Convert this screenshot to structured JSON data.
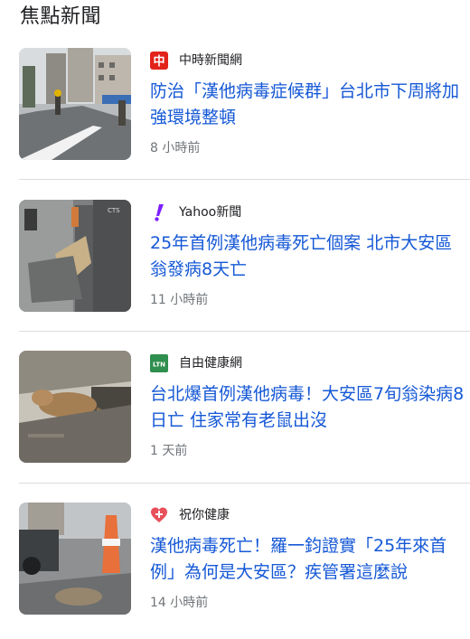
{
  "section": {
    "title": "焦點新聞"
  },
  "articles": [
    {
      "source": "中時新聞網",
      "headline": "防治「漢他病毒症候群」台北市下周將加強環境整頓",
      "time": "8 小時前"
    },
    {
      "source": "Yahoo新聞",
      "headline": "25年首例漢他病毒死亡個案 北市大安區翁發病8天亡",
      "time": "11 小時前"
    },
    {
      "source": "自由健康網",
      "source_logo_text": "LTN",
      "headline": "台北爆首例漢他病毒！大安區7旬翁染病8日亡 住家常有老鼠出沒",
      "time": "1 天前"
    },
    {
      "source": "祝你健康",
      "headline": "漢他病毒死亡！羅一鈞證實「25年來首例」為何是大安區？疾管署這麼說",
      "time": "14 小時前"
    }
  ],
  "logos": {
    "chinatimes": {
      "glyph": "中",
      "color": "#e2231a"
    },
    "yahoo": {
      "glyph": "!",
      "color": "#7e1fff"
    },
    "ltn": {
      "color": "#2f8f4e"
    },
    "health": {
      "color": "#e8505b"
    }
  },
  "colors": {
    "headline": "#1558d6",
    "meta": "#70757a",
    "divider": "#dadce0"
  }
}
